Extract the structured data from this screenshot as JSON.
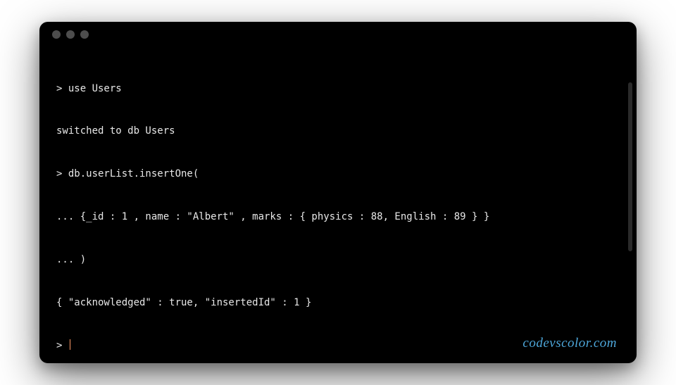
{
  "terminal": {
    "lines": [
      "> use Users",
      "switched to db Users",
      "> db.userList.insertOne(",
      "... {_id : 1 , name : \"Albert\" , marks : { physics : 88, English : 89 } }",
      "... )",
      "{ \"acknowledged\" : true, \"insertedId\" : 1 }",
      "> "
    ],
    "prompt_last": "> "
  },
  "watermark": "codevscolor.com"
}
